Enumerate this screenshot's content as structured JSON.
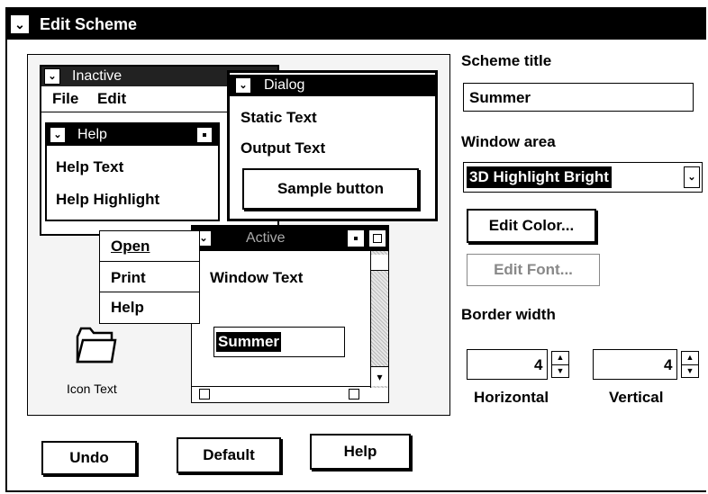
{
  "window": {
    "title": "Edit Scheme",
    "sysmenu_glyph": "⌄"
  },
  "preview": {
    "inactive": {
      "title": "Inactive",
      "menu": [
        "File",
        "Edit"
      ]
    },
    "help": {
      "title": "Help",
      "text": "Help Text",
      "highlight": "Help Highlight"
    },
    "dialog": {
      "title": "Dialog",
      "static_text": "Static Text",
      "output_text": "Output Text",
      "sample_button": "Sample button"
    },
    "menu": {
      "items": [
        "Open",
        "Print",
        "Help"
      ]
    },
    "active": {
      "title": "Active",
      "window_text": "Window Text",
      "entry": "Summer"
    },
    "icon": {
      "label": "Icon Text"
    }
  },
  "fields": {
    "scheme_title_label": "Scheme title",
    "scheme_title_value": "Summer",
    "window_area_label": "Window area",
    "window_area_value": "3D Highlight Bright",
    "edit_color": "Edit Color...",
    "edit_font": "Edit Font...",
    "border_width_label": "Border width",
    "horizontal_value": "4",
    "vertical_value": "4",
    "horizontal_label": "Horizontal",
    "vertical_label": "Vertical"
  },
  "buttons": {
    "undo": "Undo",
    "default": "Default",
    "help": "Help"
  },
  "colors": {
    "titlebar": "#000000",
    "background": "#ffffff",
    "disabled": "#888888"
  }
}
